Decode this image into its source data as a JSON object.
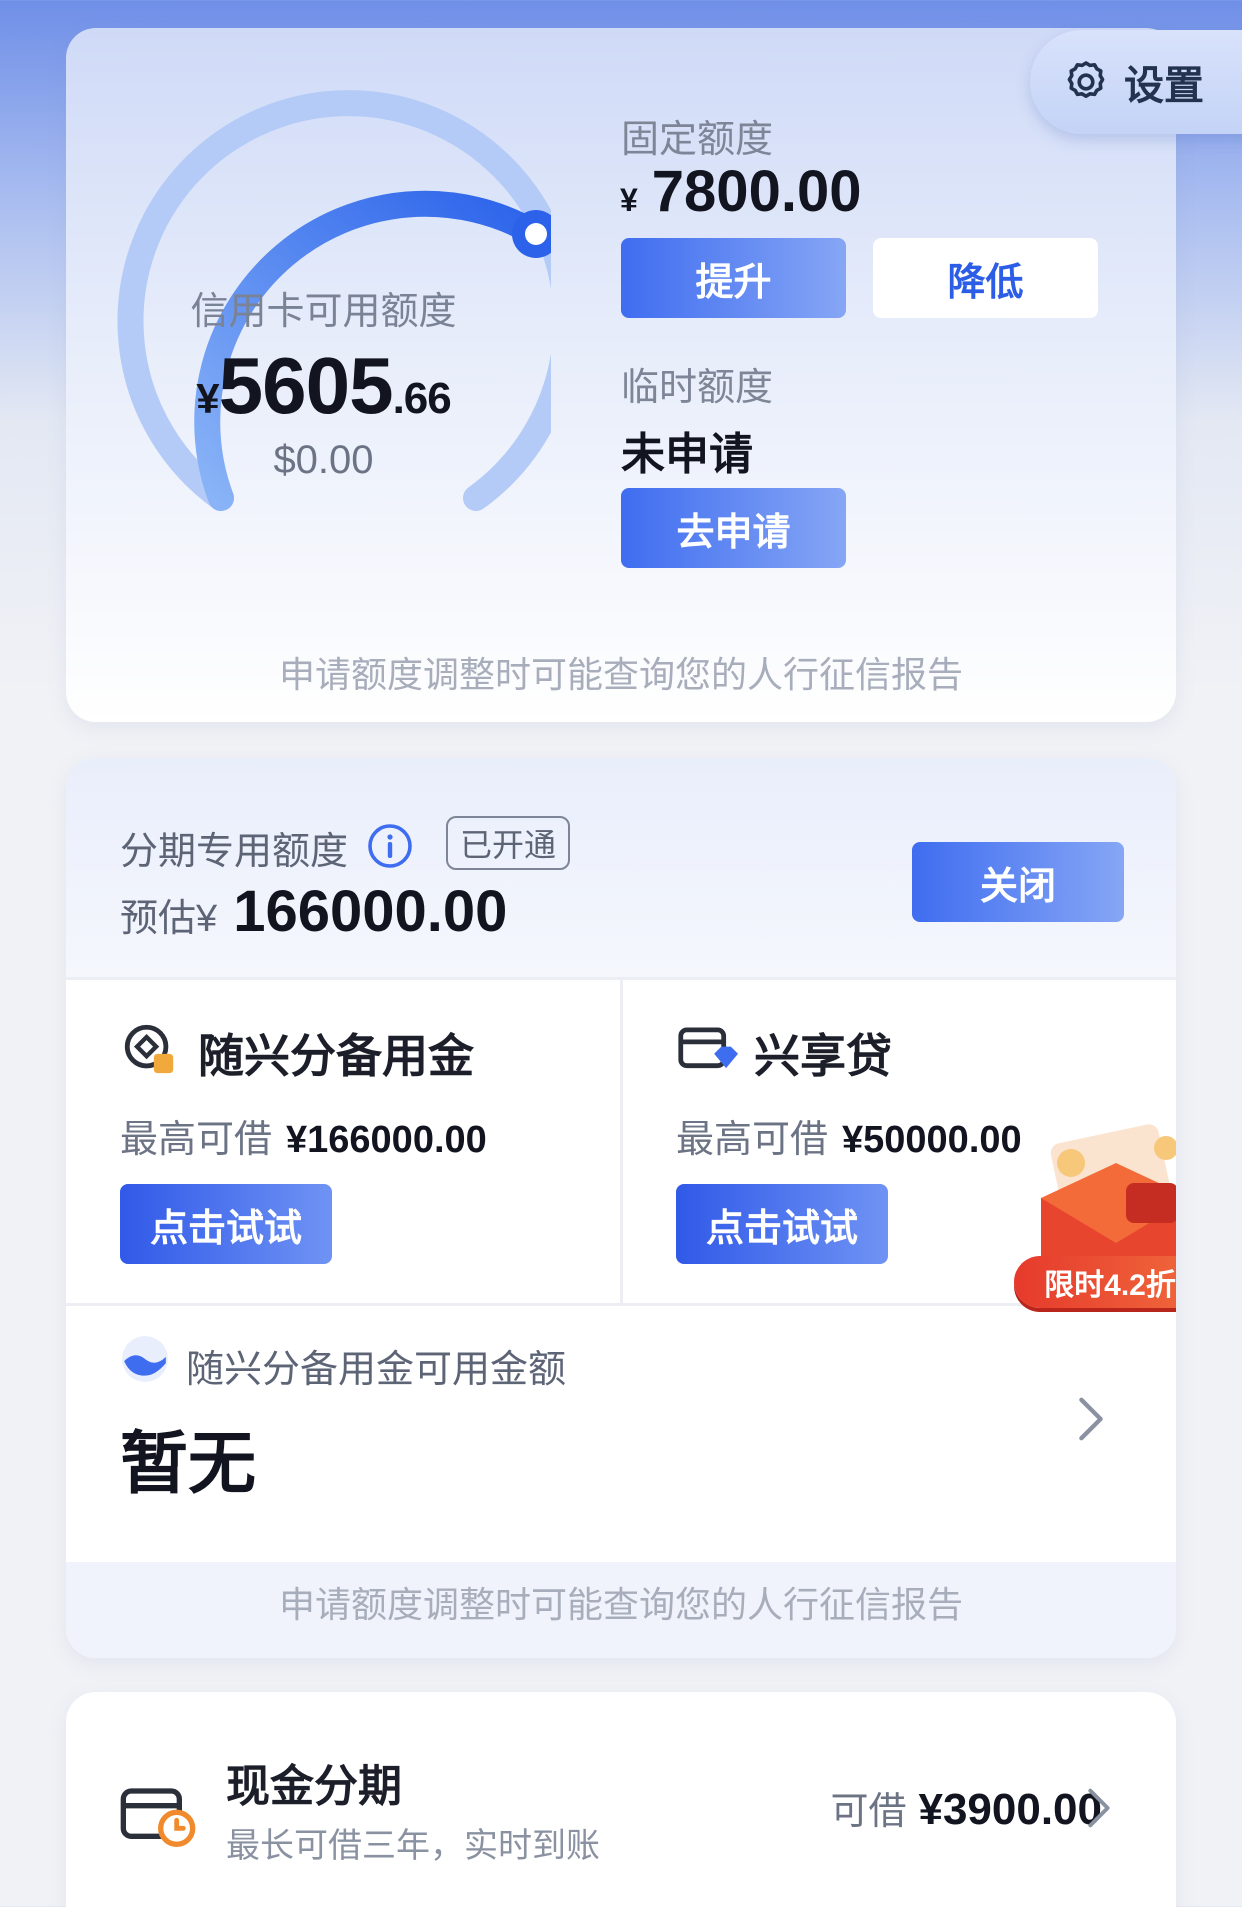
{
  "settings": {
    "label": "设置"
  },
  "limit_card": {
    "gauge_label": "信用卡可用额度",
    "available": {
      "symbol": "¥",
      "integer": "5605",
      "decimal": ".66"
    },
    "usd_amount": "$0.00",
    "fixed_label": "固定额度",
    "fixed_amount": {
      "symbol": "¥",
      "value": "7800.00"
    },
    "raise_button": "提升",
    "lower_button": "降低",
    "temp_label": "临时额度",
    "temp_status": "未申请",
    "apply_button": "去申请",
    "note": "申请额度调整时可能查询您的人行征信报告"
  },
  "installment_card": {
    "label": "分期专用额度",
    "badge": "已开通",
    "estimate_prefix": "预估¥",
    "estimate_value": "166000.00",
    "close_button": "关闭",
    "products": [
      {
        "title": "随兴分备用金",
        "max_label": "最高可借",
        "max_value": "¥166000.00",
        "button": "点击试试",
        "icon": "coin-icon"
      },
      {
        "title": "兴享贷",
        "max_label": "最高可借",
        "max_value": "¥50000.00",
        "button": "点击试试",
        "icon": "card-diamond-icon"
      }
    ],
    "promo_badge": "限时4.2折",
    "available_label": "随兴分备用金可用金额",
    "available_value": "暂无",
    "note": "申请额度调整时可能查询您的人行征信报告"
  },
  "cash_card": {
    "title": "现金分期",
    "subtitle": "最长可借三年，实时到账",
    "amount_prefix": "可借",
    "amount": "¥3900.00"
  },
  "colors": {
    "primary_blue": "#3f6df0",
    "promo_red": "#e8452f"
  }
}
